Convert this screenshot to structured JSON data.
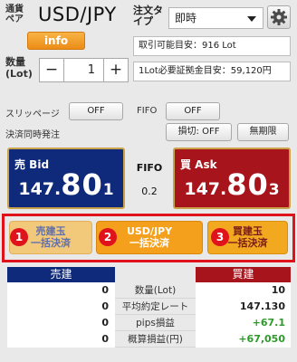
{
  "header": {
    "pair_label": "通貨ペア",
    "symbol": "USD/JPY",
    "info_label": "info",
    "order_type_label": "注文タイプ",
    "order_type_value": "即時"
  },
  "account": {
    "tradable_lot": "取引可能目安：916 Lot",
    "margin_per_lot": "1Lot必要証拠金目安：59,120円"
  },
  "quantity": {
    "label": "数量(Lot)",
    "minus_label": "−",
    "value": "1",
    "plus_label": "+"
  },
  "options": {
    "slippage_label": "スリッページ",
    "slippage_value": "OFF",
    "fifo_label": "FIFO",
    "fifo_value": "OFF",
    "simul_label": "決済同時発注",
    "stoploss_value": "損切: OFF",
    "expiry_value": "無期限"
  },
  "prices": {
    "bid_label": "売 Bid",
    "bid_main": "147.",
    "bid_big": "80",
    "bid_tail": "1",
    "ask_label": "買 Ask",
    "ask_main": "147.",
    "ask_big": "80",
    "ask_tail": "3",
    "middle_label": "FIFO",
    "spread": "0.2"
  },
  "bulk": {
    "buttons": [
      {
        "badge": "1",
        "line1": "売建玉",
        "line2": "一括決済"
      },
      {
        "badge": "2",
        "line1": "USD/JPY",
        "line2": "一括決済"
      },
      {
        "badge": "3",
        "line1": "買建玉",
        "line2": "一括決済"
      }
    ]
  },
  "positions": {
    "sell_header": "売建",
    "buy_header": "買建",
    "rows": [
      {
        "sell": "0",
        "label": "数量(Lot)",
        "buy": "10"
      },
      {
        "sell": "0",
        "label": "平均約定レート",
        "buy": "147.130"
      },
      {
        "sell": "0",
        "label": "pips損益",
        "buy": "+67.1"
      },
      {
        "sell": "0",
        "label": "概算損益(円)",
        "buy": "+67,050"
      }
    ]
  },
  "colors": {
    "bid_bg": "#0f2a7a",
    "ask_bg": "#a8141c",
    "accent_orange": "#f5a01c",
    "highlight_red": "#e0121b",
    "profit_green": "#2e9a2a"
  }
}
